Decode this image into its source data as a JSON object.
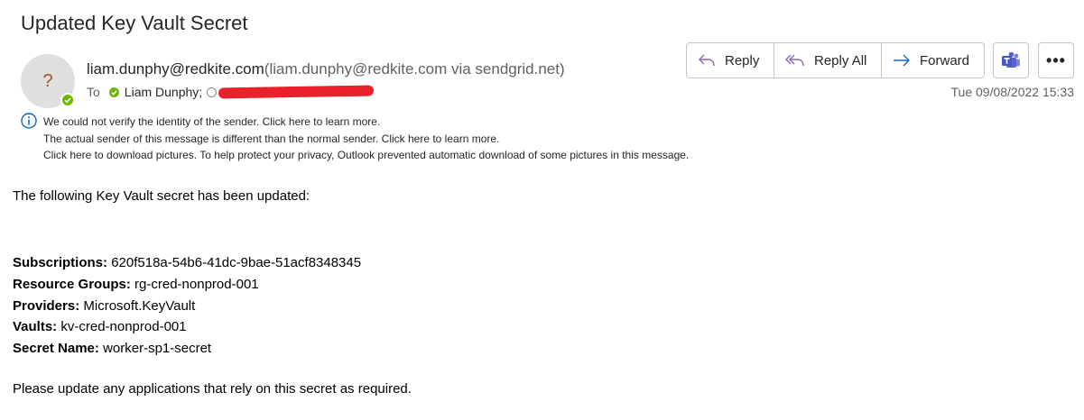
{
  "email": {
    "subject": "Updated Key Vault Secret",
    "avatar_glyph": "?",
    "sender_email": "liam.dunphy@redkite.com",
    "sender_via": "(liam.dunphy@redkite.com via sendgrid.net)",
    "to_label": "To",
    "recipients": [
      "Liam Dunphy;"
    ],
    "datetime": "Tue 09/08/2022 15:33",
    "info_lines": [
      "We could not verify the identity of the sender. Click here to learn more.",
      "The actual sender of this message is different than the normal sender. Click here to learn more.",
      "Click here to download pictures. To help protect your privacy, Outlook prevented automatic download of some pictures in this message."
    ]
  },
  "actions": {
    "reply": "Reply",
    "reply_all": "Reply All",
    "forward": "Forward",
    "teams_icon": "teams-icon",
    "more": "•••"
  },
  "body": {
    "intro": "The following Key Vault secret has been updated:",
    "fields": [
      {
        "label": "Subscriptions:",
        "value": "620f518a-54b6-41dc-9bae-51acf8348345"
      },
      {
        "label": "Resource Groups:",
        "value": "rg-cred-nonprod-001"
      },
      {
        "label": "Providers:",
        "value": "Microsoft.KeyVault"
      },
      {
        "label": "Vaults:",
        "value": "kv-cred-nonprod-001"
      },
      {
        "label": "Secret Name:",
        "value": "worker-sp1-secret"
      }
    ],
    "closing": "Please update any applications that rely on this secret as required."
  },
  "colors": {
    "presence_green": "#6bb700",
    "redaction_red": "#e8212a",
    "reply_purple": "#8764b8",
    "forward_blue": "#0f6cbd",
    "teams_purple": "#5b5fc7"
  }
}
